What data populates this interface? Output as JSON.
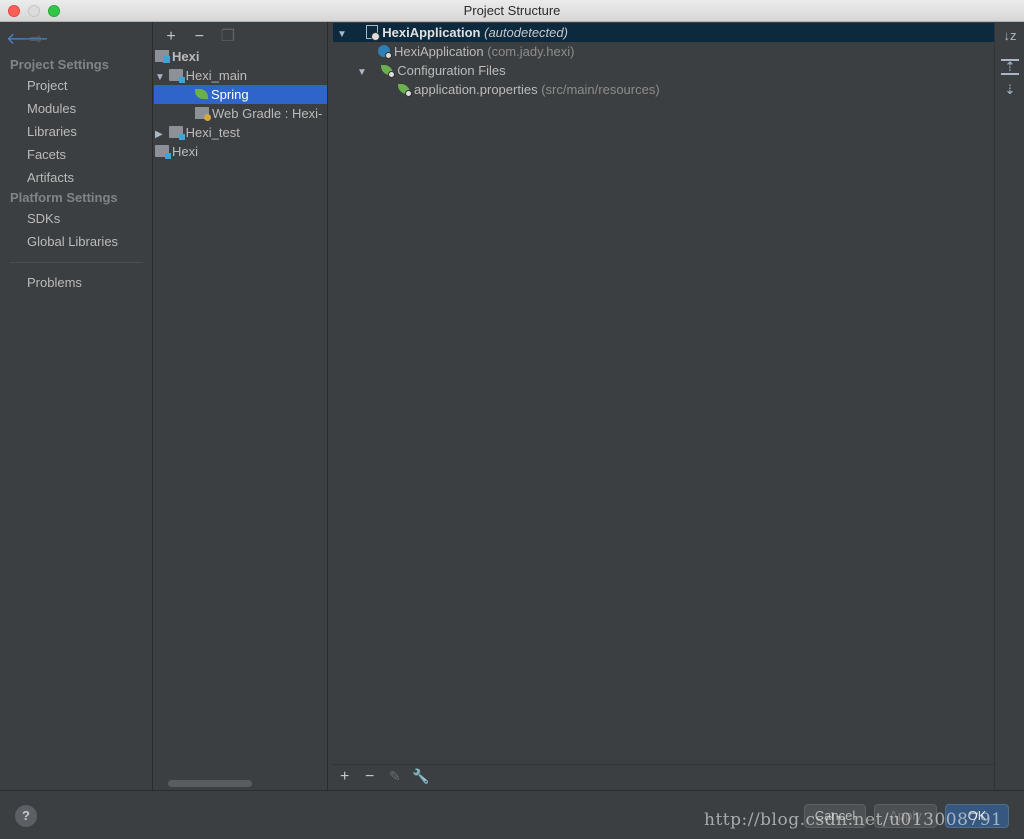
{
  "window": {
    "title": "Project Structure"
  },
  "nav": {
    "back_icon": "back-arrow-icon",
    "forward_icon": "forward-arrow-icon",
    "section_project": "Project Settings",
    "items_project": [
      "Project",
      "Modules",
      "Libraries",
      "Facets",
      "Artifacts"
    ],
    "section_platform": "Platform Settings",
    "items_platform": [
      "SDKs",
      "Global Libraries"
    ],
    "problems": "Problems"
  },
  "tree": {
    "toolbar": {
      "add": "+",
      "remove": "−",
      "copy_icon": "copy-icon"
    },
    "items": {
      "root": "Hexi",
      "main": "Hexi_main",
      "spring": "Spring",
      "web_gradle": "Web Gradle : Hexi-",
      "test": "Hexi_test",
      "hexi": "Hexi"
    }
  },
  "content": {
    "root_name": "HexiApplication",
    "root_suffix": "(autodetected)",
    "app_name": "HexiApplication",
    "app_package": "(com.jady.hexi)",
    "config_files": "Configuration Files",
    "props_name": "application.properties",
    "props_path": "(src/main/resources)",
    "bottom_toolbar": {
      "add": "+",
      "remove": "−",
      "edit_icon": "pencil-icon",
      "settings_icon": "wrench-icon"
    }
  },
  "vtoolbar": {
    "sort": "↓z",
    "expand": "⇡",
    "collapse": "⇣"
  },
  "footer": {
    "help": "?",
    "cancel": "Cancel",
    "apply": "Apply",
    "ok": "OK",
    "watermark": "http://blog.csdn.net/u013008791"
  }
}
